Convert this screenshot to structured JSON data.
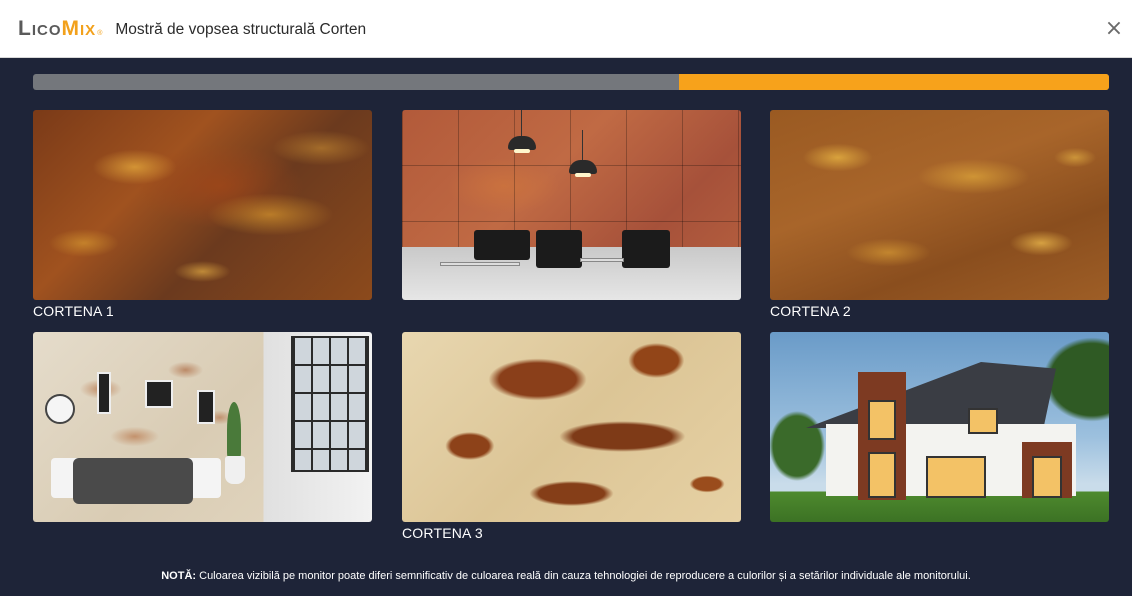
{
  "header": {
    "logo_lico": "Lico",
    "logo_mix": "Mix",
    "logo_reg": "®",
    "title": "Mostră de vopsea structurală Corten",
    "close_glyph": "×"
  },
  "progress": {
    "percent_complete": 60,
    "bar_color": "#74777c",
    "fill_color": "#f7a21b"
  },
  "gallery": {
    "items": [
      {
        "caption": "CORTENA 1"
      },
      {
        "caption": ""
      },
      {
        "caption": "CORTENA 2"
      },
      {
        "caption": ""
      },
      {
        "caption": "CORTENA 3"
      },
      {
        "caption": ""
      }
    ]
  },
  "note": {
    "label": "NOTĂ:",
    "text": " Culoarea vizibilă pe monitor poate diferi semnificativ de culoarea reală din cauza tehnologiei de reproducere a culorilor și a setărilor individuale ale monitorului."
  },
  "colors": {
    "background": "#1e2438",
    "header_bg": "#ffffff",
    "accent": "#f2a11c"
  }
}
